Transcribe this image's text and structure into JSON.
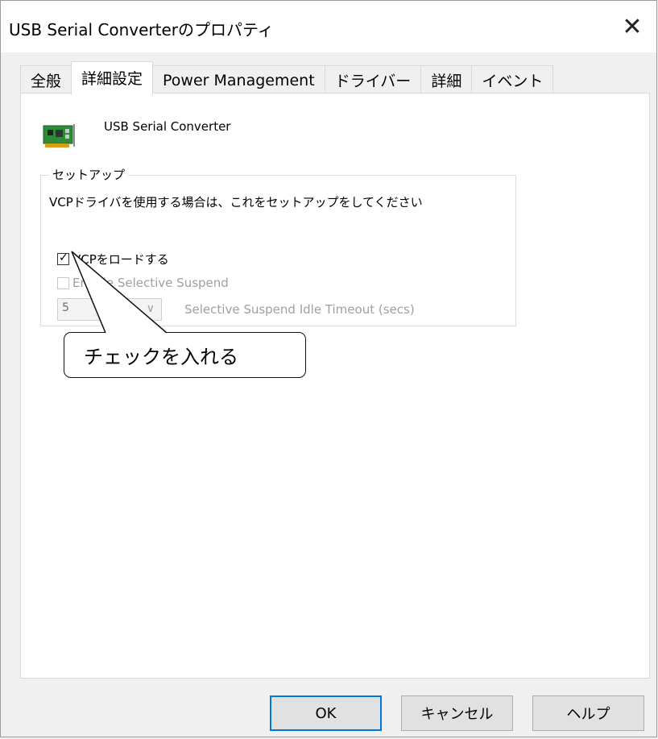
{
  "window": {
    "title": "USB Serial Converterのプロパティ",
    "close_glyph": "✕"
  },
  "tabs": [
    {
      "label": "全般",
      "active": false
    },
    {
      "label": "詳細設定",
      "active": true
    },
    {
      "label": "Power Management",
      "active": false
    },
    {
      "label": "ドライバー",
      "active": false
    },
    {
      "label": "詳細",
      "active": false
    },
    {
      "label": "イベント",
      "active": false
    }
  ],
  "device": {
    "name": "USB Serial Converter",
    "icon": "network-card-icon"
  },
  "setup": {
    "legend": "セットアップ",
    "description": "VCPドライバを使用する場合は、これをセットアップをしてください",
    "load_vcp": {
      "label": "VCPをロードする",
      "checked": true
    },
    "selective_suspend": {
      "label": "Enable Selective Suspend",
      "checked": false,
      "enabled": false
    },
    "timeout": {
      "value": "5",
      "label": "Selective Suspend Idle Timeout (secs)",
      "enabled": false
    }
  },
  "callout": {
    "text": "チェックを入れる"
  },
  "buttons": {
    "ok": "OK",
    "cancel": "キャンセル",
    "help": "ヘルプ"
  },
  "colors": {
    "accent": "#0078d7",
    "disabled_text": "#a0a0a0"
  }
}
